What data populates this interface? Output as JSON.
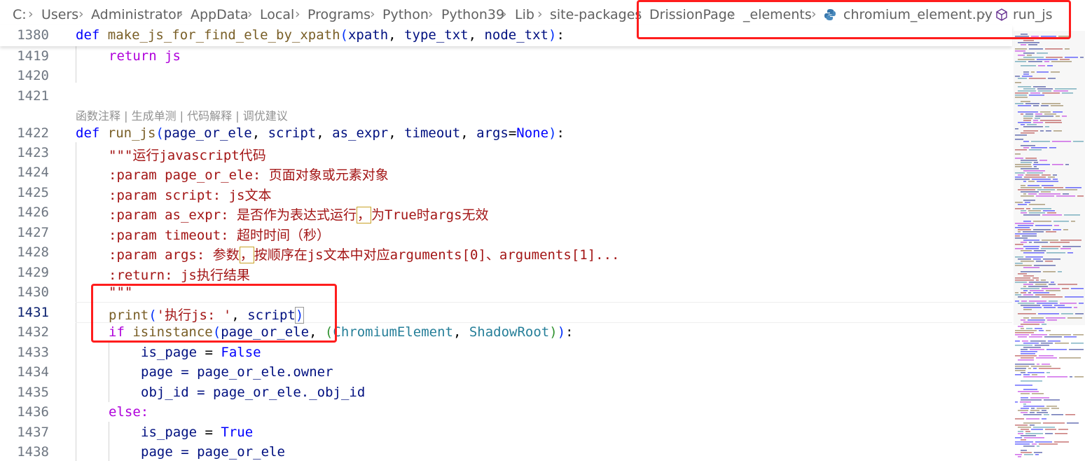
{
  "breadcrumb": {
    "segments": [
      "C:",
      "Users",
      "Administrator",
      "AppData",
      "Local",
      "Programs",
      "Python",
      "Python39",
      "Lib",
      "site-packages",
      "DrissionPage",
      "_elements",
      "chromium_element.py",
      "run_js"
    ],
    "separator": ">"
  },
  "sticky": {
    "line": "1380",
    "code": "def make_js_for_find_ele_by_xpath(xpath, type_txt, node_txt):"
  },
  "codelens": "函数注释 | 生成单测 | 代码解释 | 调优建议",
  "lines": {
    "l1419": "1419",
    "l1420": "1420",
    "l1421": "1421",
    "l1422": "1422",
    "l1423": "1423",
    "l1424": "1424",
    "l1425": "1425",
    "l1426": "1426",
    "l1427": "1427",
    "l1428": "1428",
    "l1429": "1429",
    "l1430": "1430",
    "l1431": "1431",
    "l1432": "1432",
    "l1433": "1433",
    "l1434": "1434",
    "l1435": "1435",
    "l1436": "1436",
    "l1437": "1437",
    "l1438": "1438"
  },
  "code": {
    "r1419": "return js",
    "doc1": "\"\"\"运行javascript代码",
    "doc2": ":param page_or_ele: 页面对象或元素对象",
    "doc3": ":param script: js文本",
    "doc4a": ":param as_expr: 是否作为表达式运行",
    "doc4b": "，",
    "doc4c": "为True时args无效",
    "doc5": ":param timeout: 超时时间（秒）",
    "doc6a": ":param args: 参数",
    "doc6b": "，",
    "doc6c": "按顺序在js文本中对应arguments[0]、arguments[1]...",
    "doc7": ":return: js执行结果",
    "doc8": "\"\"\"",
    "print_str": "'执行js: '",
    "is_page_false": "is_page = False",
    "page_owner": "page = page_or_ele.owner",
    "obj_id": "obj_id = page_or_ele._obj_id",
    "else": "else:",
    "is_page_true": "is_page = True",
    "page_ele": "page = page_or_ele"
  },
  "colors": {
    "highlight_box": "#ff1d1d",
    "keyword": "#0000ff",
    "function": "#795e26",
    "string": "#a31515"
  },
  "icons": [
    "chevron-right-icon",
    "python-file-icon",
    "symbol-method-icon"
  ]
}
